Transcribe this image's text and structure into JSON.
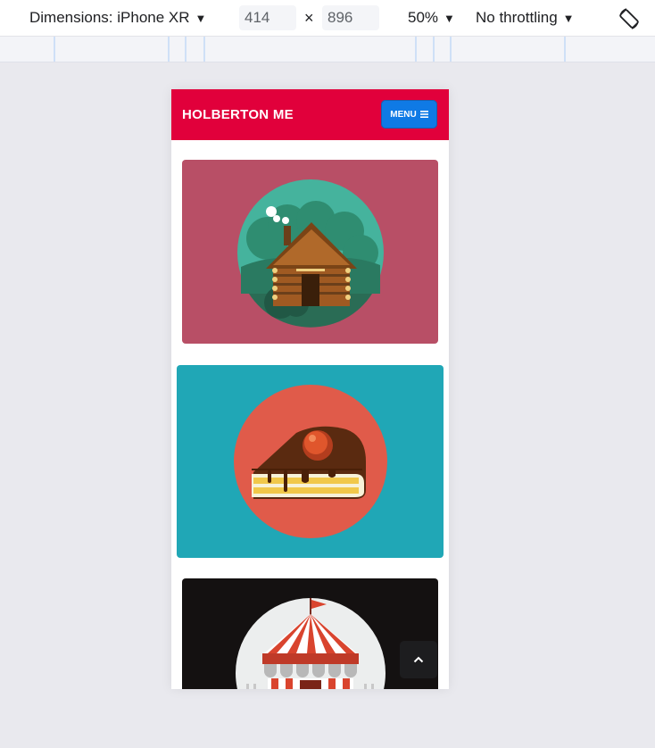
{
  "devtools": {
    "dimensions_label": "Dimensions: iPhone XR",
    "width_value": "414",
    "times_symbol": "×",
    "height_value": "896",
    "zoom_label": "50%",
    "throttling_label": "No throttling",
    "icons": {
      "dropdown": "caret-down-icon",
      "rotate": "rotate-device-icon"
    }
  },
  "site": {
    "brand": "HOLBERTON ME",
    "menu_label": "MENU",
    "colors": {
      "header": "#e1003b",
      "menu_button": "#0f7ae5",
      "card1": "#b84f66",
      "card2": "#20a7b6",
      "card3": "#141111"
    },
    "cards": [
      {
        "illustration": "log-cabin-illustration"
      },
      {
        "illustration": "cake-slice-illustration"
      },
      {
        "illustration": "circus-tent-illustration"
      }
    ],
    "icons": {
      "menu": "hamburger-icon",
      "scroll_top": "chevron-up-icon"
    }
  }
}
